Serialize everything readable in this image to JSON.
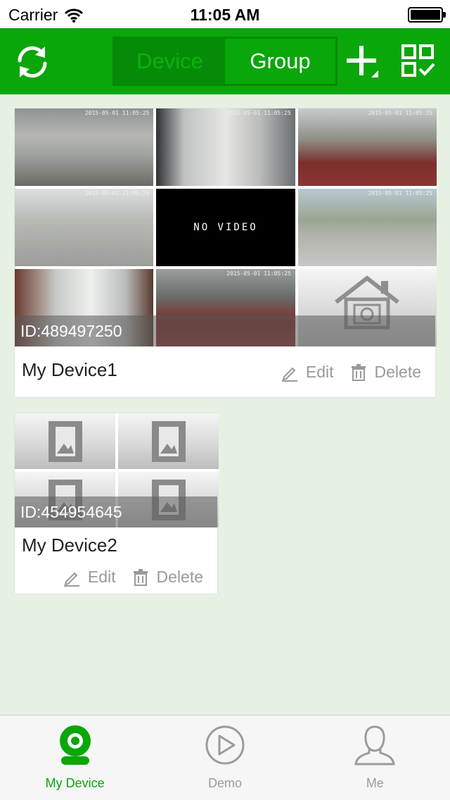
{
  "status_bar": {
    "carrier": "Carrier",
    "time": "11:05 AM"
  },
  "nav": {
    "segments": [
      "Device",
      "Group"
    ],
    "active_segment": "Device",
    "icons": [
      "refresh-icon",
      "add-icon",
      "qr-scan-icon"
    ]
  },
  "devices": [
    {
      "id_label": "ID:489497250",
      "name": "My Device1",
      "edit_label": "Edit",
      "delete_label": "Delete",
      "channels": [
        {
          "timestamp": "2015-05-01 11:05:25"
        },
        {
          "timestamp": "2015-05-01 11:05:25"
        },
        {
          "timestamp": "2015-05-01 11:05:25"
        },
        {
          "timestamp": "2015-05-01 11:05:25"
        },
        {
          "text": "NO VIDEO"
        },
        {
          "timestamp": "2015-05-01 11:05:25"
        },
        {
          "timestamp": ""
        },
        {
          "timestamp": "2015-05-01 11:05:25"
        },
        {
          "icon": "home-camera-icon"
        }
      ]
    },
    {
      "id_label": "ID:454954645",
      "name": "My Device2",
      "edit_label": "Edit",
      "delete_label": "Delete",
      "channels": [
        {
          "icon": "video-film-icon"
        },
        {
          "icon": "video-film-icon"
        },
        {
          "icon": "video-film-icon"
        },
        {
          "icon": "video-film-icon"
        }
      ]
    }
  ],
  "tabs": [
    {
      "label": "My Device",
      "icon": "webcam-icon",
      "active": true
    },
    {
      "label": "Demo",
      "icon": "play-circle-icon",
      "active": false
    },
    {
      "label": "Me",
      "icon": "person-icon",
      "active": false
    }
  ],
  "colors": {
    "brand_green": "#09a70a",
    "background": "#e6f1e4",
    "muted_text": "#9a9a9a"
  }
}
